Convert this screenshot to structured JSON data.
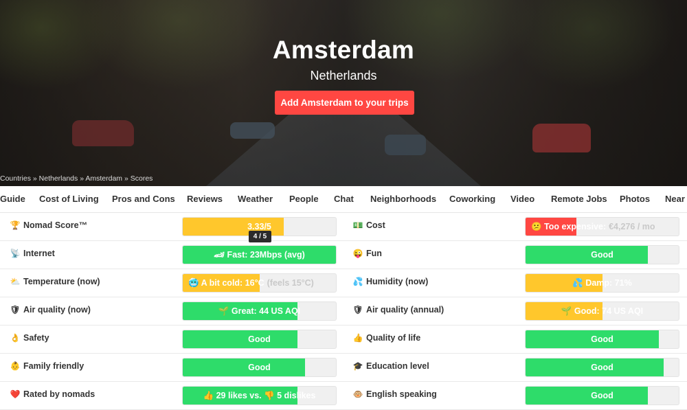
{
  "hero": {
    "city": "Amsterdam",
    "country": "Netherlands",
    "cta_label": "Add Amsterdam to your trips",
    "breadcrumb": [
      "Countries",
      "Netherlands",
      "Amsterdam",
      "Scores"
    ],
    "breadcrumb_sep": "»"
  },
  "tabs": [
    "Guide",
    "Cost of Living",
    "Pros and Cons",
    "Reviews",
    "Weather",
    "People",
    "Chat",
    "Neighborhoods",
    "Coworking",
    "Video",
    "Remote Jobs",
    "Photos",
    "Near"
  ],
  "colors": {
    "green": "#2edc6a",
    "yellow": "#ffc72c",
    "red": "#ff4742",
    "cta": "#ff4742"
  },
  "scores": {
    "left": [
      {
        "icon": "🏆",
        "icon_name": "trophy-icon",
        "label": "Nomad Score™",
        "text": "3.33/5",
        "value": 0.66,
        "color": "yellow",
        "tooltip": "4 / 5"
      },
      {
        "icon": "📡",
        "icon_name": "satellite-icon",
        "label": "Internet",
        "text": "🏎 Fast: 23Mbps (avg)",
        "value": 1.0,
        "color": "green"
      },
      {
        "icon": "⛅",
        "icon_name": "weather-icon",
        "label": "Temperature (now)",
        "text": "🥶 A bit cold: 16°C",
        "text_extra": "(feels 15°C)",
        "value": 0.5,
        "color": "yellow"
      },
      {
        "icon": "🛡",
        "icon_name": "shield-icon",
        "label": "Air quality (now)",
        "text": "🌱 Great: 44 US AQI",
        "value": 0.75,
        "color": "green"
      },
      {
        "icon": "👌",
        "icon_name": "ok-hand-icon",
        "label": "Safety",
        "text": "Good",
        "value": 0.75,
        "color": "green"
      },
      {
        "icon": "👶",
        "icon_name": "baby-icon",
        "label": "Family friendly",
        "text": "Good",
        "value": 0.8,
        "color": "green"
      },
      {
        "icon": "❤️",
        "icon_name": "heart-icon",
        "label": "Rated by nomads",
        "text": "👍 29 likes vs. 👎 5 dislikes",
        "value": 0.75,
        "color": "green"
      }
    ],
    "right": [
      {
        "icon": "💵",
        "icon_name": "money-icon",
        "label": "Cost",
        "text": "😕 Too expensive:",
        "text_extra": "€4,276 / mo",
        "value": 0.33,
        "color": "red"
      },
      {
        "icon": "😜",
        "icon_name": "fun-icon",
        "label": "Fun",
        "text": "Good",
        "value": 0.8,
        "color": "green"
      },
      {
        "icon": "💦",
        "icon_name": "humidity-icon",
        "label": "Humidity (now)",
        "text": "💦 Damp: 71%",
        "value": 0.5,
        "color": "yellow"
      },
      {
        "icon": "🛡",
        "icon_name": "shield-icon",
        "label": "Air quality (annual)",
        "text": "🌱 Good: 74 US AQI",
        "value": 0.5,
        "color": "yellow"
      },
      {
        "icon": "👍",
        "icon_name": "thumbs-up-icon",
        "label": "Quality of life",
        "text": "Good",
        "value": 0.87,
        "color": "green"
      },
      {
        "icon": "🎓",
        "icon_name": "graduation-cap-icon",
        "label": "Education level",
        "text": "Good",
        "value": 0.9,
        "color": "green"
      },
      {
        "icon": "🐵",
        "icon_name": "monkey-icon",
        "label": "English speaking",
        "text": "Good",
        "value": 0.8,
        "color": "green"
      }
    ]
  }
}
